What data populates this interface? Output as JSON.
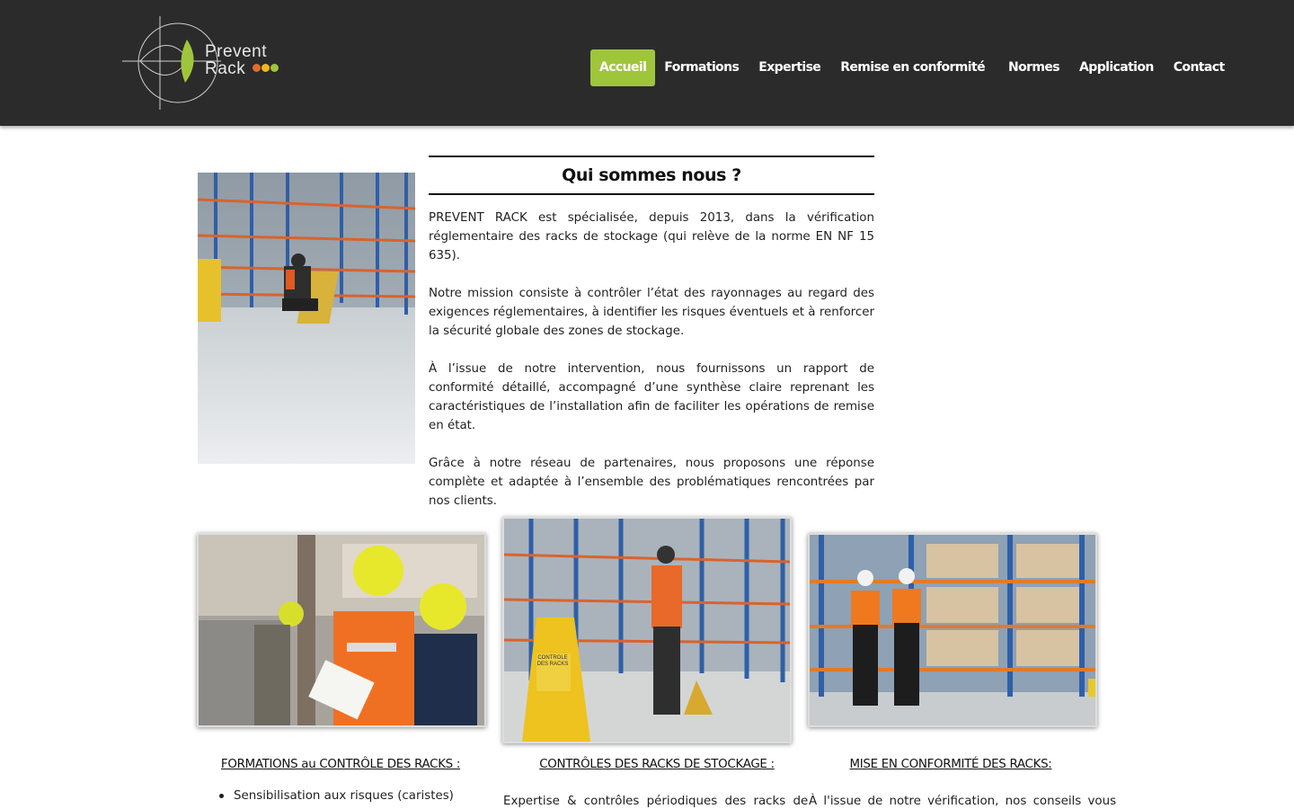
{
  "brand": {
    "line1": "Prevent",
    "line2": "Rack",
    "dot_colors": [
      "#e36b2c",
      "#f1b81c",
      "#9fc63b"
    ]
  },
  "colors": {
    "header_bg": "#2b2b2b",
    "accent": "#9fc63b"
  },
  "nav": {
    "items": [
      {
        "label": "Accueil",
        "active": true
      },
      {
        "label": "Formations",
        "active": false
      },
      {
        "label": "Expertise",
        "active": false
      },
      {
        "label": "Remise en conformité",
        "active": false
      },
      {
        "label": "Normes",
        "active": false
      },
      {
        "label": "Application",
        "active": false
      },
      {
        "label": "Contact",
        "active": false
      }
    ]
  },
  "intro": {
    "title": "Qui sommes nous ?",
    "paragraphs": [
      "PREVENT RACK est spécialisée, depuis 2013, dans la vérification réglementaire des racks de stockage (qui relève de la norme EN NF 15 635).",
      "Notre mission consiste à contrôler l’état des rayonnages au regard des exigences réglementaires, à identifier les risques éventuels et à renforcer la sécurité globale des zones de stockage.",
      "À l’issue de notre intervention, nous fournissons un rapport de conformité détaillé, accompagné d’une synthèse claire reprenant les caractéristiques de l’installation afin de faciliter les opérations de remise en état.",
      "Grâce à notre réseau de partenaires, nous proposons une réponse complète et adaptée à l’ensemble des problématiques rencontrées par nos clients."
    ]
  },
  "cards": [
    {
      "title": "FORMATIONS au CONTRÔLE DES RACKS :",
      "bullet": "Sensibilisation aux risques (caristes)"
    },
    {
      "title": "CONTRÔLES DES RACKS DE STOCKAGE :",
      "text": "Expertise & contrôles périodiques des racks de"
    },
    {
      "title": "MISE EN CONFORMITÉ DES RACKS:",
      "text": "À l'issue de notre vérification, nos conseils vous"
    }
  ],
  "images": {
    "intro_photo": "photo-inspector-warehouse",
    "card1_photo": "photo-workers-hardhats",
    "card2_photo": "photo-rack-control-sign",
    "card3_photo": "photo-two-inspectors-walking",
    "sign_text": "CONTROLE DES RACKS"
  }
}
